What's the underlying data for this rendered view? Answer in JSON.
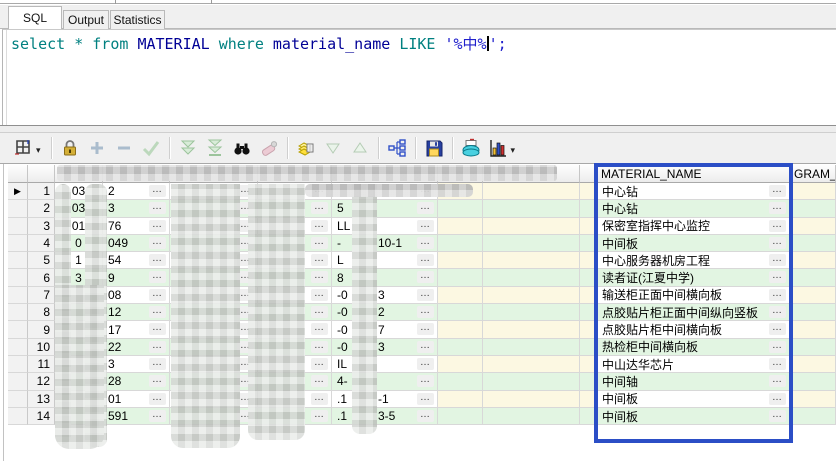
{
  "tabs": [
    {
      "label": "SQL",
      "active": true
    },
    {
      "label": "Output",
      "active": false
    },
    {
      "label": "Statistics",
      "active": false
    }
  ],
  "sql_editor": {
    "tokens": [
      {
        "text": "select ",
        "type": "keyword"
      },
      {
        "text": "* ",
        "type": "keyword"
      },
      {
        "text": "from ",
        "type": "keyword"
      },
      {
        "text": "MATERIAL ",
        "type": "identifier"
      },
      {
        "text": "where ",
        "type": "keyword"
      },
      {
        "text": "material_name ",
        "type": "identifier"
      },
      {
        "text": "LIKE ",
        "type": "keyword"
      },
      {
        "text": "'%中%",
        "type": "string",
        "caret": true
      },
      {
        "text": "';",
        "type": "string"
      }
    ],
    "colors": {
      "keyword": "#008080",
      "identifier": "#000096",
      "string": "#2020cc"
    }
  },
  "toolbar": {
    "buttons": [
      {
        "name": "grid-options",
        "dropdown": true
      },
      {
        "name": "lock-record"
      },
      {
        "name": "insert-record",
        "disabled": true
      },
      {
        "name": "delete-record",
        "disabled": true
      },
      {
        "name": "post-changes",
        "disabled": true
      },
      {
        "name": "fetch-next-page",
        "disabled": true
      },
      {
        "name": "fetch-all-rows",
        "disabled": true
      },
      {
        "name": "find"
      },
      {
        "name": "clear",
        "disabled": true
      },
      {
        "name": "export-data"
      },
      {
        "name": "sort-descending",
        "disabled": true
      },
      {
        "name": "sort-ascending",
        "disabled": true
      },
      {
        "name": "data-structure-view"
      },
      {
        "name": "save-results"
      },
      {
        "name": "print"
      },
      {
        "name": "chart",
        "dropdown": true
      }
    ]
  },
  "grid": {
    "headers": {
      "material_name": "MATERIAL_NAME",
      "gram": "GRAM_"
    },
    "row_indicator": "▶",
    "ellipsis_glyph": "…",
    "colors": {
      "row_alt": "#e2f5e2",
      "cream": "#fcf8e2",
      "highlight_border": "#2b4ec6"
    },
    "rows": [
      {
        "num": "1",
        "a": "03",
        "b": "2",
        "e1": "",
        "e2": "",
        "name": "中心钻"
      },
      {
        "num": "2",
        "a": "03",
        "b": "3",
        "e1": "5",
        "e2": "",
        "name": "中心钻"
      },
      {
        "num": "3",
        "a": "01",
        "b": "76",
        "e1": "LL",
        "e2": "",
        "name": "保密室指挥中心监控"
      },
      {
        "num": "4",
        "a": "0",
        "b": "049",
        "e1": "-",
        "e2": "10-1",
        "name": "中间板"
      },
      {
        "num": "5",
        "a": "1",
        "b": "54",
        "e1": "L",
        "e2": "",
        "name": "中心服务器机房工程"
      },
      {
        "num": "6",
        "a": "3",
        "b": "9",
        "e1": "8",
        "e2": "",
        "name": "读者证(江夏中学)"
      },
      {
        "num": "7",
        "a": "",
        "b": "08",
        "e1": "-0",
        "e2": "3",
        "name": "输送柜正面中间横向板"
      },
      {
        "num": "8",
        "a": "",
        "b": "12",
        "e1": "-0",
        "e2": "2",
        "name": "点胶贴片柜正面中间纵向竖板"
      },
      {
        "num": "9",
        "a": "",
        "b": "17",
        "e1": "-0",
        "e2": "7",
        "name": "点胶贴片柜中间横向板"
      },
      {
        "num": "10",
        "a": "",
        "b": "22",
        "e1": "-0",
        "e2": "3",
        "name": "热检柜中间横向板"
      },
      {
        "num": "11",
        "a": "",
        "b": "3",
        "e1": "IL",
        "e2": "",
        "name": "中山达华芯片"
      },
      {
        "num": "12",
        "a": "",
        "b": "28",
        "e1": "4-",
        "e2": "",
        "name": "中间轴"
      },
      {
        "num": "13",
        "a": "",
        "b": "01",
        "e1": ".1",
        "e2": "-1",
        "name": "中间板"
      },
      {
        "num": "14",
        "a": "",
        "b": "591",
        "e1": ".1",
        "e2": "3-5",
        "name": "中间板"
      }
    ]
  }
}
